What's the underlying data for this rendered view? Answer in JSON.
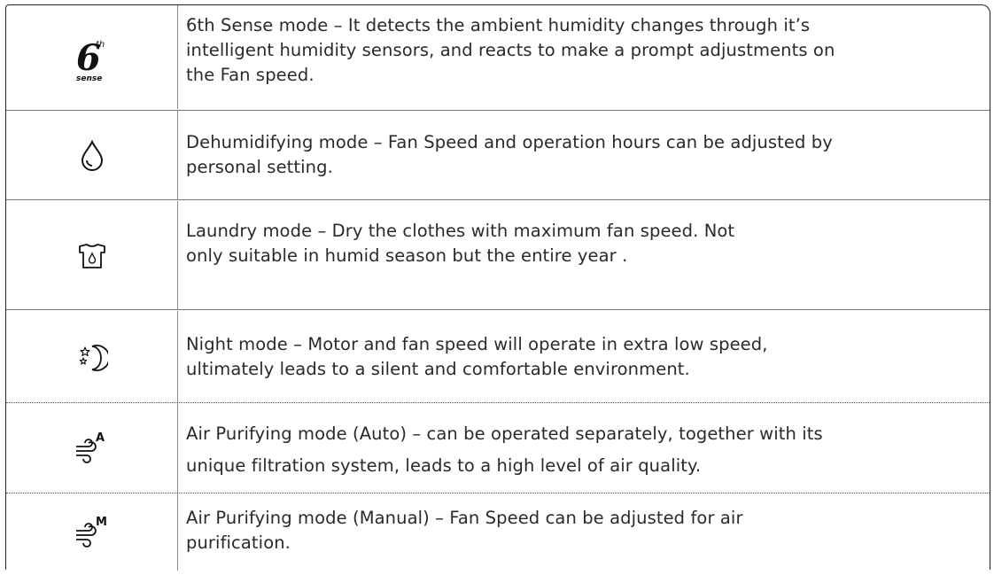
{
  "modes": [
    {
      "icon": "sixth-sense-icon",
      "icon_text_main": "6",
      "icon_text_sup": "th",
      "icon_text_sub": "sense",
      "lines": [
        "6th Sense mode – It detects the ambient humidity changes through it’s",
        "intelligent humidity sensors, and reacts to make a prompt adjustments on",
        "the Fan speed."
      ]
    },
    {
      "icon": "water-drop-icon",
      "lines": [
        "Dehumidifying mode – Fan Speed and operation hours can be adjusted by",
        "personal setting."
      ]
    },
    {
      "icon": "shirt-drop-icon",
      "lines": [
        "Laundry mode – Dry the clothes  with maximum  fan speed.  Not",
        "only suitable in humid  season but the entire year ."
      ]
    },
    {
      "icon": "moon-stars-icon",
      "lines": [
        "Night mode – Motor and fan speed will operate in extra low speed,",
        "ultimately leads to a silent and comfortable environment."
      ]
    },
    {
      "icon": "air-flow-auto-icon",
      "icon_text_sup": "A",
      "lines": [
        "Air Purifying mode (Auto) – can be operated separately, together with its",
        "unique filtration system, leads to a high level of air quality."
      ]
    },
    {
      "icon": "air-flow-manual-icon",
      "icon_text_sup": "M",
      "lines": [
        "Air Purifying mode (Manual) – Fan Speed can be adjusted for air",
        "purification."
      ]
    }
  ]
}
